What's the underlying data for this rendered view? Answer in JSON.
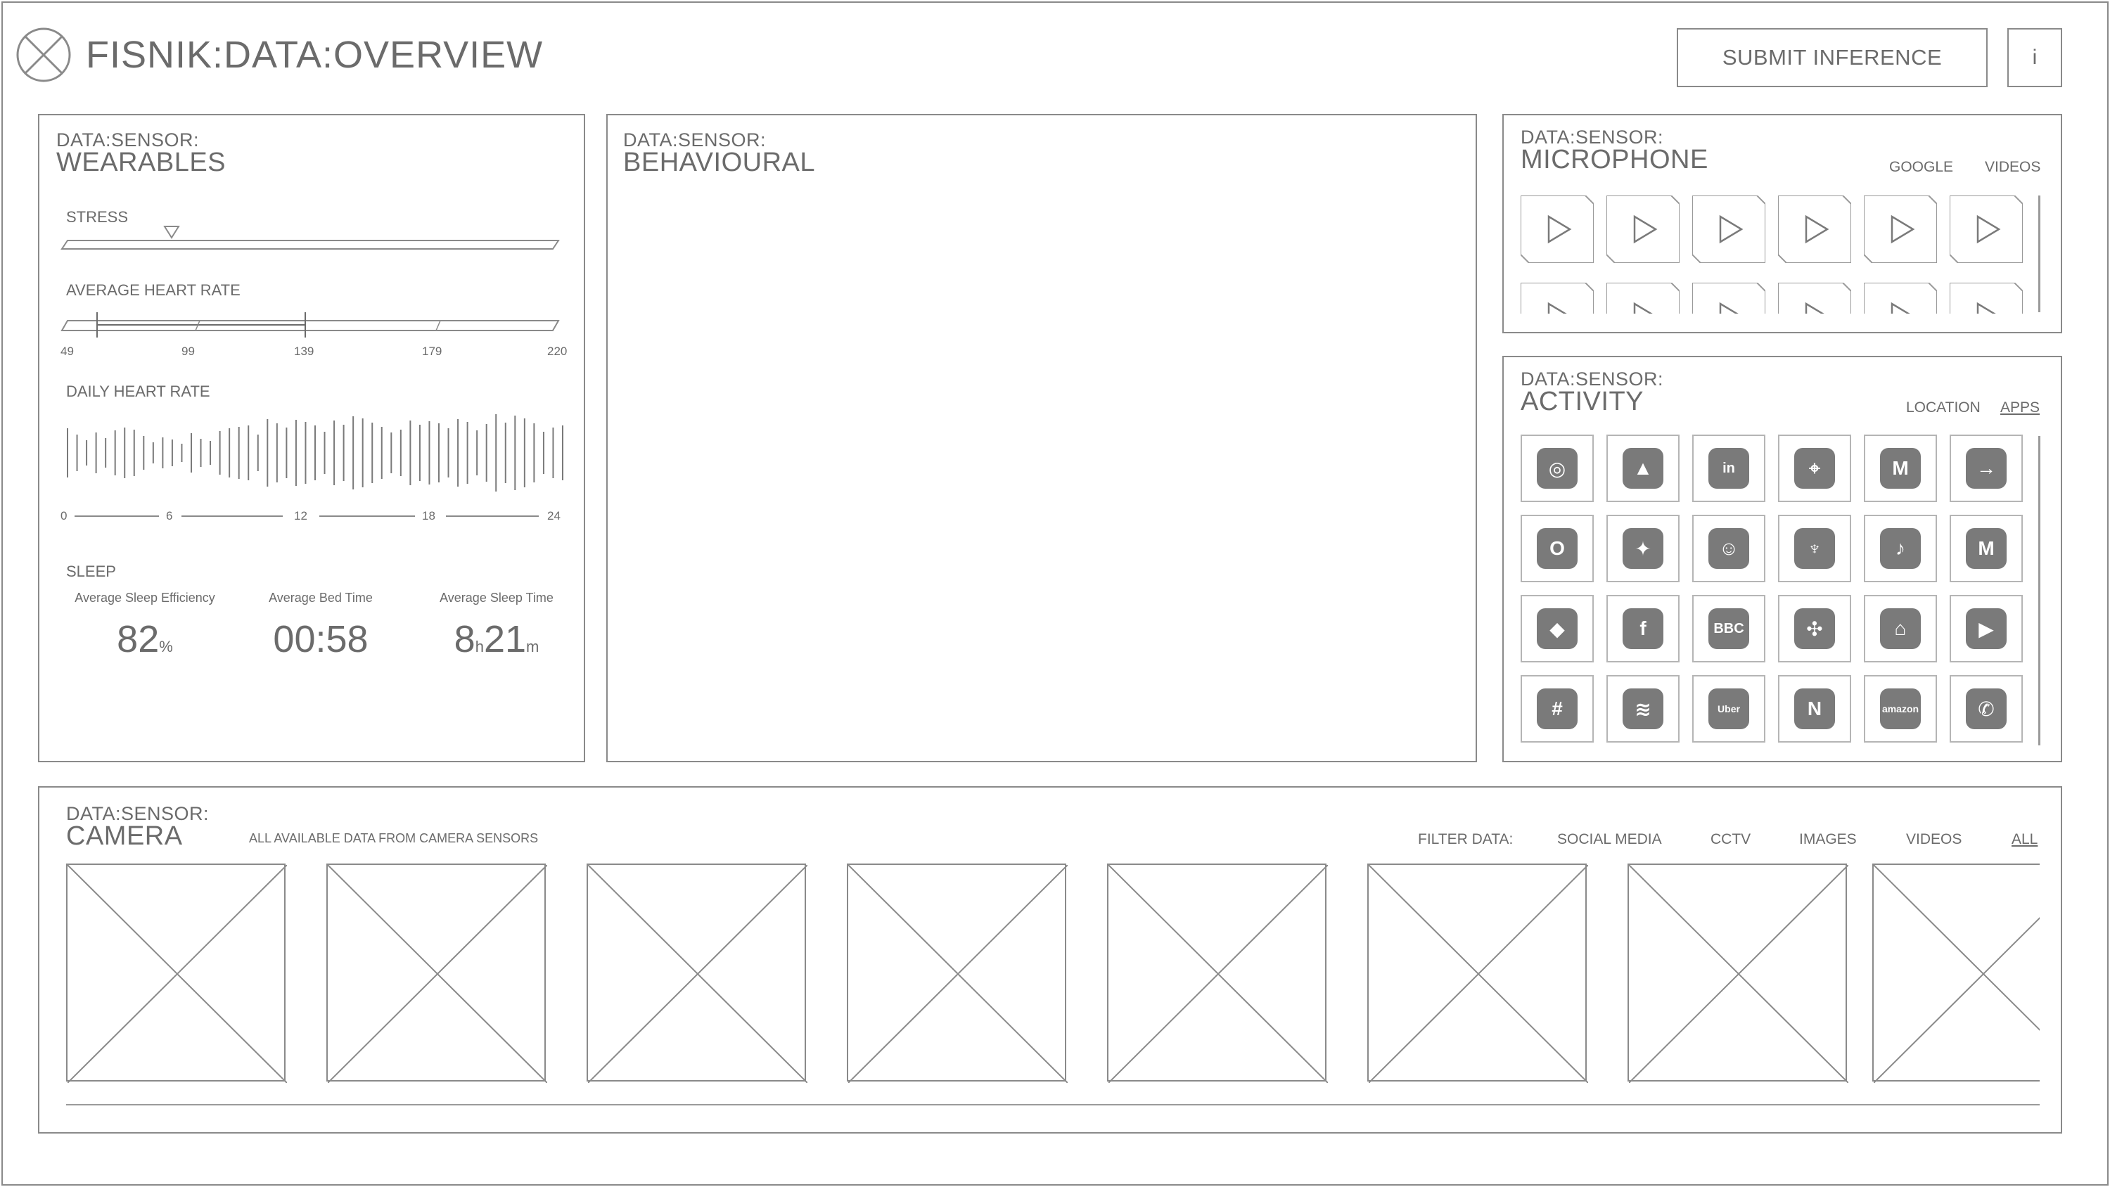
{
  "header": {
    "title": "FISNIK:DATA:OVERVIEW",
    "submit_label": "SUBMIT INFERENCE",
    "info_label": "i"
  },
  "wearables": {
    "kicker": "DATA:SENSOR:",
    "title": "WEARABLES",
    "stress_label": "STRESS",
    "avg_hr_label": "AVERAGE HEART RATE",
    "avg_hr_ticks": [
      "49",
      "99",
      "139",
      "179",
      "220"
    ],
    "daily_hr_label": "DAILY HEART RATE",
    "daily_hr_ticks": [
      "0",
      "6",
      "12",
      "18",
      "24"
    ],
    "sleep_label": "SLEEP",
    "sleep_efficiency_label": "Average Sleep Efficiency",
    "sleep_efficiency_value": "82",
    "sleep_efficiency_unit": "%",
    "bed_time_label": "Average Bed Time",
    "bed_time_value": "00:58",
    "sleep_time_label": "Average Sleep Time",
    "sleep_time_hours": "8",
    "sleep_time_h_unit": "h",
    "sleep_time_minutes": "21",
    "sleep_time_m_unit": "m"
  },
  "behavioural": {
    "kicker": "DATA:SENSOR:",
    "title": "BEHAVIOURAL"
  },
  "microphone": {
    "kicker": "DATA:SENSOR:",
    "title": "MICROPHONE",
    "tabs": [
      "GOOGLE",
      "VIDEOS"
    ]
  },
  "activity": {
    "kicker": "DATA:SENSOR:",
    "title": "ACTIVITY",
    "tabs": [
      "LOCATION",
      "APPS"
    ],
    "active_tab": "APPS",
    "apps": [
      {
        "icon": "instagram-icon",
        "glyph": "◎"
      },
      {
        "icon": "google-drive-icon",
        "glyph": "▲"
      },
      {
        "icon": "linkedin-icon",
        "glyph": "in"
      },
      {
        "icon": "maps-pin-icon",
        "glyph": "⌖"
      },
      {
        "icon": "monzo-icon",
        "glyph": "M"
      },
      {
        "icon": "arrow-circle-icon",
        "glyph": "→"
      },
      {
        "icon": "outlook-icon",
        "glyph": "O"
      },
      {
        "icon": "twitter-icon",
        "glyph": "✦"
      },
      {
        "icon": "snapchat-icon",
        "glyph": "☺"
      },
      {
        "icon": "barclays-eagle-icon",
        "glyph": "♆"
      },
      {
        "icon": "tiktok-icon",
        "glyph": "♪"
      },
      {
        "icon": "gmail-icon",
        "glyph": "M"
      },
      {
        "icon": "dropbox-icon",
        "glyph": "◆"
      },
      {
        "icon": "facebook-icon",
        "glyph": "f"
      },
      {
        "icon": "bbc-news-icon",
        "glyph": "BBC"
      },
      {
        "icon": "photos-pinwheel-icon",
        "glyph": "✣"
      },
      {
        "icon": "home-icon",
        "glyph": "⌂"
      },
      {
        "icon": "youtube-icon",
        "glyph": "▶"
      },
      {
        "icon": "slack-icon",
        "glyph": "#"
      },
      {
        "icon": "spotify-icon",
        "glyph": "≋"
      },
      {
        "icon": "uber-icon",
        "glyph": "Uber"
      },
      {
        "icon": "netflix-icon",
        "glyph": "N"
      },
      {
        "icon": "amazon-icon",
        "glyph": "amazon"
      },
      {
        "icon": "whatsapp-icon",
        "glyph": "✆"
      }
    ]
  },
  "camera": {
    "kicker": "DATA:SENSOR:",
    "title": "CAMERA",
    "subtitle": "ALL AVAILABLE DATA FROM CAMERA SENSORS",
    "filter_label": "FILTER DATA:",
    "filters": [
      "SOCIAL MEDIA",
      "CCTV",
      "IMAGES",
      "VIDEOS",
      "ALL"
    ],
    "active_filter": "ALL"
  },
  "colors": {
    "line": "#8a8a8a",
    "text": "#6b6b6b",
    "icon_fill": "#7a7a7a"
  }
}
